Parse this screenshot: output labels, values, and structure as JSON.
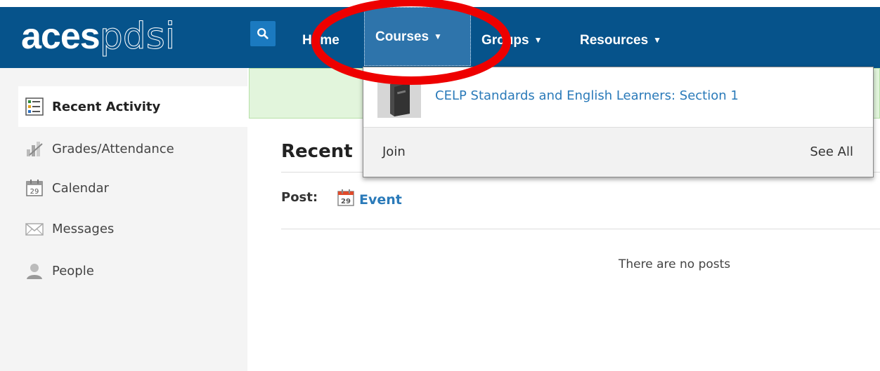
{
  "header": {
    "logo_bold": "aces",
    "logo_thin": "pdsi",
    "nav": {
      "home": "Home",
      "courses": "Courses",
      "groups": "Groups",
      "resources": "Resources"
    },
    "caret": "▼"
  },
  "sidebar": {
    "items": [
      {
        "label": "Recent Activity",
        "icon": "recent-activity-icon"
      },
      {
        "label": "Grades/Attendance",
        "icon": "grades-icon"
      },
      {
        "label": "Calendar",
        "icon": "calendar-icon"
      },
      {
        "label": "Messages",
        "icon": "envelope-icon"
      },
      {
        "label": "People",
        "icon": "person-icon"
      }
    ],
    "calendar_day": "29"
  },
  "main": {
    "heading": "Recent",
    "post_label": "Post:",
    "event_label": "Event",
    "event_day": "29",
    "empty_text": "There are no posts"
  },
  "dropdown": {
    "course_name": "CELP Standards and English Learners: Section 1",
    "join_label": "Join",
    "see_all_label": "See All"
  },
  "colors": {
    "navbar": "#06538b",
    "active_nav": "#2e74ab",
    "link": "#2a7ab9",
    "alert_bg": "#e2f5dc",
    "annotation_ring": "#ee0000"
  }
}
